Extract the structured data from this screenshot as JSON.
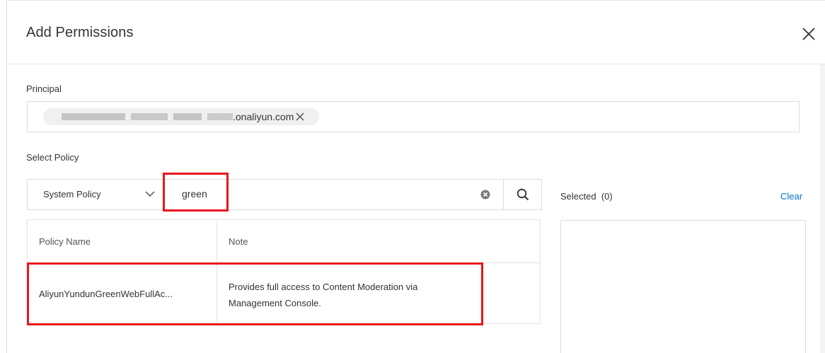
{
  "dialog": {
    "title": "Add Permissions",
    "close_icon": "close-icon"
  },
  "principal": {
    "label": "Principal",
    "tag_text": ".onaliyun.com",
    "tag_remove_icon": "close-icon"
  },
  "policy": {
    "label": "Select Policy",
    "type_selected": "System Policy",
    "search_value": "green",
    "search_placeholder": "",
    "clear_icon": "clear-circle-icon",
    "search_icon": "search-icon",
    "table": {
      "columns": [
        "Policy Name",
        "Note"
      ],
      "rows": [
        {
          "name": "AliyunYundunGreenWebFullAc...",
          "note_line1": "Provides full access to Content Moderation via",
          "note_line2": "Management Console."
        }
      ]
    }
  },
  "selected": {
    "label": "Selected",
    "count": "(0)",
    "clear_label": "Clear"
  },
  "colors": {
    "highlight": "#e8161d",
    "link": "#0070cc",
    "border": "#dcdcdc"
  }
}
